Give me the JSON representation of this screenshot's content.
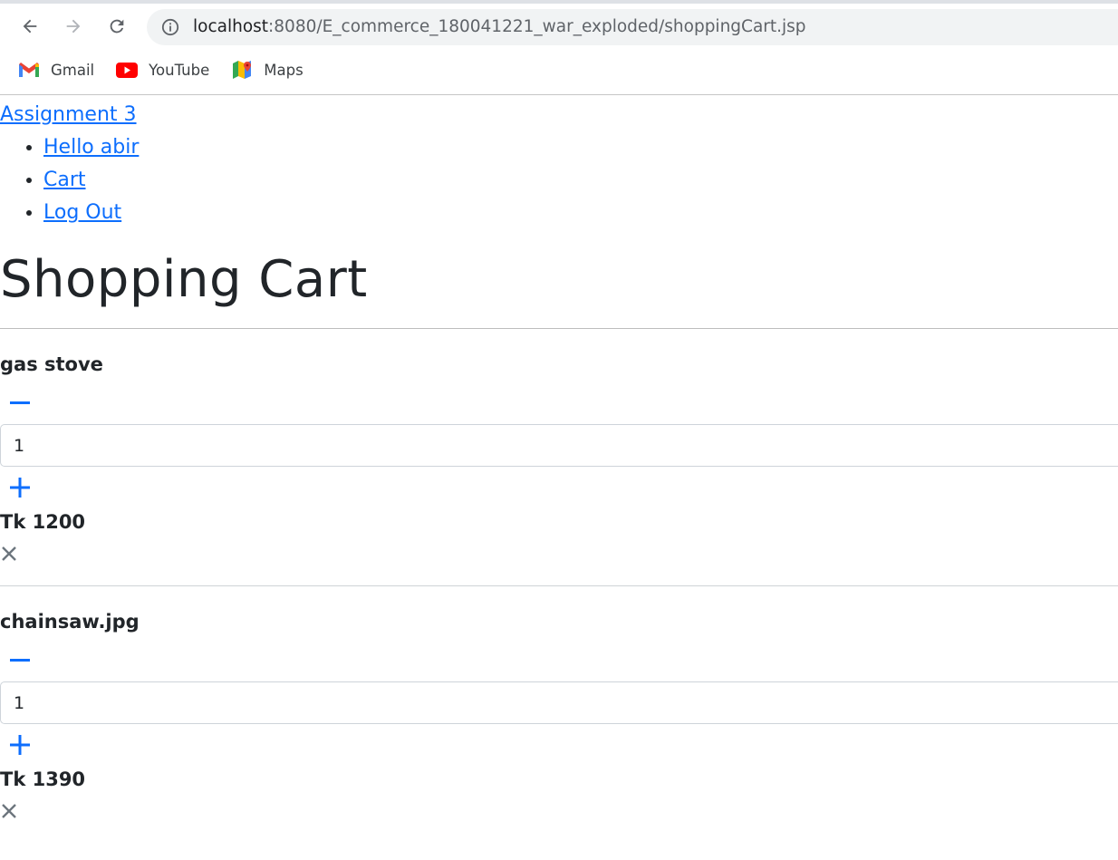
{
  "browser": {
    "url_host": "localhost",
    "url_path": ":8080/E_commerce_180041221_war_exploded/shoppingCart.jsp",
    "bookmarks": [
      {
        "label": "Gmail",
        "icon": "gmail-icon"
      },
      {
        "label": "YouTube",
        "icon": "youtube-icon"
      },
      {
        "label": "Maps",
        "icon": "maps-icon"
      }
    ]
  },
  "nav": {
    "brand": "Assignment 3",
    "links": [
      "Hello abir",
      "Cart",
      "Log Out"
    ]
  },
  "page": {
    "title": "Shopping Cart"
  },
  "cart": {
    "items": [
      {
        "name": "gas stove",
        "quantity": "1",
        "price": "Tk 1200"
      },
      {
        "name": "chainsaw.jpg",
        "quantity": "1",
        "price": "Tk 1390"
      }
    ]
  },
  "colors": {
    "link": "#0d6efd",
    "text": "#212529",
    "remove": "#6c757d"
  }
}
